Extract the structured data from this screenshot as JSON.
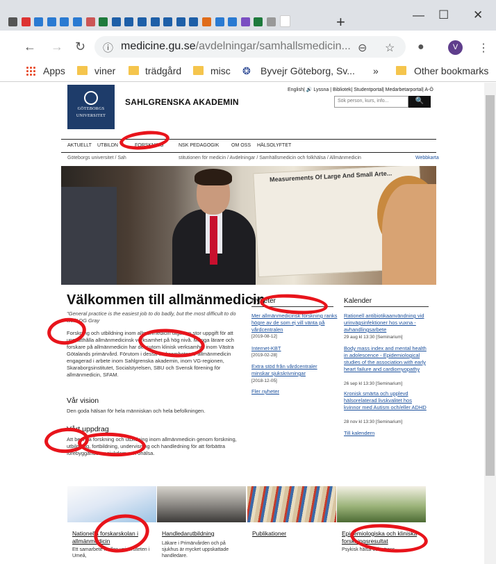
{
  "browser": {
    "url_host": "medicine.gu.se",
    "url_path": "/avdelningar/samhallsmedicin...",
    "window_controls": [
      "—",
      "☐",
      "✕"
    ],
    "new_tab": "+",
    "avatar_letter": "V",
    "bookmarks": [
      "Apps",
      "viner",
      "trädgård",
      "misc",
      "Byvejr Göteborg, Sv...",
      "»",
      "Other bookmarks"
    ]
  },
  "site": {
    "logo_lines": [
      "GÖTEBORGS",
      "UNIVERSITET"
    ],
    "name": "SAHLGRENSKA AKADEMIN",
    "utility_links": "English| 🔊 Lyssna | Bibliotek| Studentportal| Medarbetarportal| A-Ö",
    "search_placeholder": "Sök person, kurs, info...",
    "search_icon": "search-icon",
    "nav": [
      "AKTUELLT",
      "UTBILDN",
      "FORSKNING",
      "NSK PEDAGOGIK",
      "OM OSS",
      "HÄLSOLYFTET"
    ],
    "breadcrumb_start": "Göteborgs universitet / Sah",
    "breadcrumb_end": "stitutionen för medicin / Avdelningar / Samhällsmedicin och folkhälsa / Allmänmedicin",
    "sitemap": "Webbkarta"
  },
  "hero": {
    "poster_title": "Measurements Of Large And Small Arte..."
  },
  "main": {
    "title": "Välkommen till allmänmedicin",
    "quote": "\"General practice is the easiest job to do badly, but the most difficult to do well\" DG Gray",
    "intro": "Forskning och utbildning inom allmänmedicin utgör en stor uppgift för att upprätthålla allmänmedicinsk verksamhet på hög nivå. Många lärare och forskare på allmänmedicin har dessutom klinisk verksamhet inom Västra Götalands primärvård. Förutom i dessa verksamheter är allmänmedicin engagerad i arbete inom Sahlgrenska akademin, inom VG-regionen, Skaraborgsinstitutet, Socialstyrelsen, SBU och Svensk förening för allmänmedicin, SFAM.",
    "vision_heading": "Vår vision",
    "vision_text": "Den goda hälsan för hela människan och hela befolkningen.",
    "mission_heading": "Vårt uppdrag",
    "mission_text": "Att bedriva forskning och utbildning inom allmänmedicin genom forskning, utbildning, fortbildning, undervisning och handledning för att förbättra förebyggande av sjukdom och ohälsa."
  },
  "news": {
    "heading": "Nyheter",
    "items": [
      {
        "title": "Mer allmänmedicinsk forskning ranks högre av de som ej vill vänta på vårdcentralen",
        "date": "[2019-08-12]"
      },
      {
        "title": "Internet-KBT",
        "date": "[2019-02-28]"
      },
      {
        "title": "Extra stöd från vårdcentraler minskar sjukskrivningar",
        "date": "[2018-12-05]"
      }
    ],
    "more": "Fler nyheter"
  },
  "calendar": {
    "heading": "Kalender",
    "items": [
      {
        "title": "Rationell antibiotikaanvändning vid urinvägsinfektioner hos vuxna - avhandlingsarbete",
        "meta": "29 aug kl 13:30 [Seminarium]"
      },
      {
        "title": "Body mass index and mental health in adolescence - Epidemiological studies of the association with early heart failure and cardiomyopathy",
        "meta": "26 sep kl 13:30 [Seminarium]"
      },
      {
        "title": "Kronisk smärta och upplevd hälsorelaterad livskvalitet hos kvinnor med Autism och/eller ADHD",
        "meta": "28 nov kl 13:30 [Seminarium]"
      }
    ],
    "all": "Till kalendern"
  },
  "cards": [
    {
      "title": "Nationella forskarskolan i allmänmedicin",
      "body": "Ett samarbete mellan universiteten i Umeå,"
    },
    {
      "title": "Handledarutbildning",
      "body": "Läkare i Primärvården och på sjukhus är mycket uppskattade handledare."
    },
    {
      "title": "Publikationer",
      "body": ""
    },
    {
      "title": "Epidemiologiska och kliniska forskningsresultat",
      "body": "Psykisk hälsa och stress"
    }
  ]
}
